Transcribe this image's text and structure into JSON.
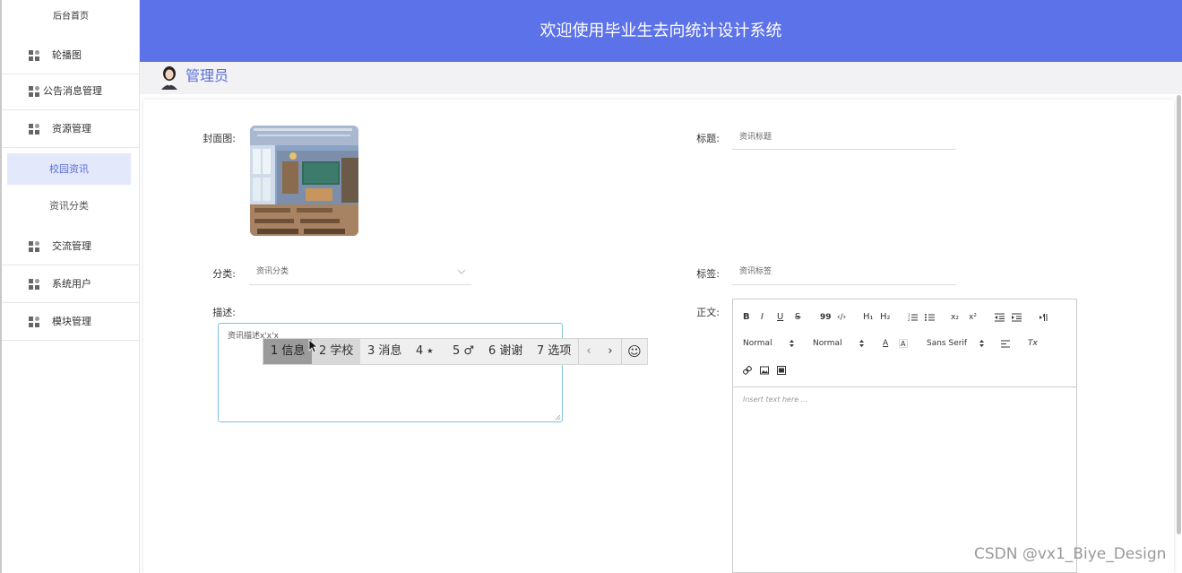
{
  "sidebar": {
    "home": "后台首页",
    "items": [
      {
        "label": "轮播图"
      },
      {
        "label": "公告消息管理"
      },
      {
        "label": "资源管理"
      },
      {
        "label": "交流管理"
      },
      {
        "label": "系统用户"
      },
      {
        "label": "模块管理"
      }
    ],
    "sub_items": [
      {
        "label": "校园资讯",
        "active": true
      },
      {
        "label": "资讯分类",
        "active": false
      }
    ]
  },
  "header": {
    "title": "欢迎使用毕业生去向统计设计系统"
  },
  "user": {
    "name": "管理员"
  },
  "form": {
    "cover_label": "封面图:",
    "title_label": "标题:",
    "title_value": "资讯标题",
    "category_label": "分类:",
    "category_value": "资讯分类",
    "tag_label": "标签:",
    "tag_value": "资讯标签",
    "desc_label": "描述:",
    "desc_value": "资讯描述x'x'x",
    "body_label": "正文:"
  },
  "ime": {
    "candidates": [
      "1 信息",
      "2 学校",
      "3 消息",
      "4 ⭑",
      "5 ♂",
      "6 谢谢",
      "7 选项"
    ],
    "prev": "‹",
    "next": "›",
    "emoji": "☺"
  },
  "editor": {
    "bold": "B",
    "italic": "I",
    "underline": "U",
    "strike": "S",
    "quote": "99",
    "code": "‹/›",
    "h1": "H₁",
    "h2": "H₂",
    "sub": "x₂",
    "sup": "x²",
    "size_select": "Normal",
    "header_select": "Normal",
    "font_select": "Sans Serif",
    "color": "A",
    "clean": "Tx",
    "placeholder": "Insert text here ..."
  },
  "watermark": "CSDN @vx1_Biye_Design",
  "colors": {
    "header_bg": "#5c72e8",
    "accent": "#5b6fd6",
    "active_bg": "#e3e8fb"
  }
}
